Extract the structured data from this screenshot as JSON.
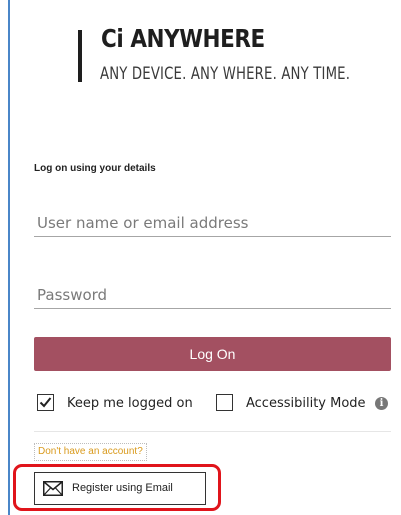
{
  "brand": {
    "title": "Ci ANYWHERE",
    "tagline": "ANY DEVICE. ANY WHERE. ANY TIME."
  },
  "login": {
    "heading": "Log on using your details",
    "username_placeholder": "User name or email address",
    "password_placeholder": "Password",
    "logon_label": "Log On",
    "keep_logged_on_label": "Keep me logged on",
    "keep_logged_on_checked": true,
    "accessibility_label": "Accessibility Mode",
    "accessibility_checked": false,
    "info_glyph": "i"
  },
  "register": {
    "account_link": "Don't have an account?",
    "register_label": "Register using Email"
  },
  "icons": {
    "info": "info-icon",
    "mail": "envelope-icon",
    "check": "checkmark-icon"
  },
  "colors": {
    "accent": "#a35061",
    "link": "#d99a1c",
    "highlight": "#e0141b",
    "frame": "#4a86c8"
  }
}
